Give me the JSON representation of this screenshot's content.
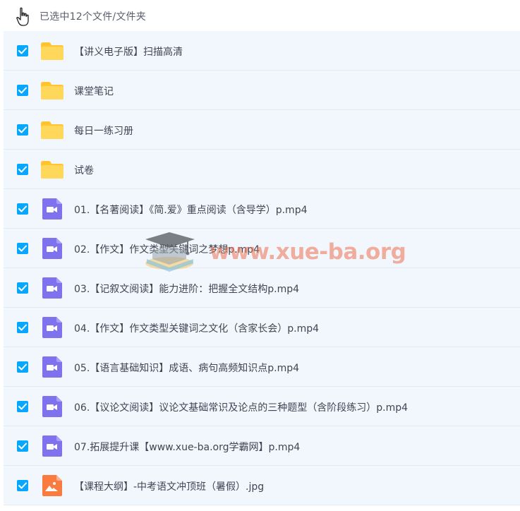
{
  "header": {
    "selection_text": "已选中12个文件/文件夹"
  },
  "colors": {
    "checkbox": "#06a7ff",
    "folder": "#ffd140",
    "video": "#7e72ee",
    "image": "#fb7a3e",
    "row_bg": "#f2f7fd"
  },
  "files": [
    {
      "name": "【讲义电子版】扫描高清",
      "type": "folder-icon",
      "checked": true
    },
    {
      "name": "课堂笔记",
      "type": "folder-icon",
      "checked": true
    },
    {
      "name": "每日一练习册",
      "type": "folder-icon",
      "checked": true
    },
    {
      "name": "试卷",
      "type": "folder-icon",
      "checked": true
    },
    {
      "name": "01.【名著阅读】《简.爱》重点阅读（含导学）p.mp4",
      "type": "video-file-icon",
      "checked": true
    },
    {
      "name": "02.【作文】作文类型关键词之梦想p.mp4",
      "type": "video-file-icon",
      "checked": true
    },
    {
      "name": "03.【记叙文阅读】能力进阶：把握全文结构p.mp4",
      "type": "video-file-icon",
      "checked": true
    },
    {
      "name": "04.【作文】作文类型关键词之文化（含家长会）p.mp4",
      "type": "video-file-icon",
      "checked": true
    },
    {
      "name": "05.【语言基础知识】成语、病句高频知识点p.mp4",
      "type": "video-file-icon",
      "checked": true
    },
    {
      "name": "06.【议论文阅读】议论文基础常识及论点的三种题型（含阶段练习）p.mp4",
      "type": "video-file-icon",
      "checked": true
    },
    {
      "name": "07.拓展提升课【www.xue-ba.org学霸网】p.mp4",
      "type": "video-file-icon",
      "checked": true
    },
    {
      "name": "【课程大纲】-中考语文冲顶班（暑假）.jpg",
      "type": "image-file-icon",
      "checked": true
    }
  ],
  "watermark": {
    "text": "www.xue-ba.org"
  }
}
